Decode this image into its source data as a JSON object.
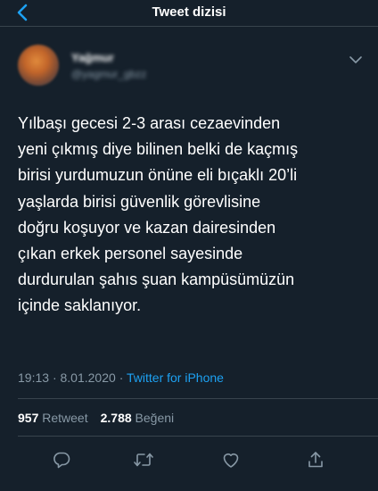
{
  "header": {
    "title": "Tweet dizisi",
    "back_icon": "chevron-left-icon"
  },
  "author": {
    "name": "Yağmur",
    "handle": "@yagmur_gbzz",
    "avatar_icon": "avatar",
    "menu_icon": "chevron-down-icon"
  },
  "tweet": {
    "lines": [
      "Yılbaşı gecesi 2-3 arası cezaevinden",
      "yeni çıkmış diye bilinen belki de kaçmış",
      "birisi yurdumuzun önüne eli bıçaklı 20’li",
      "yaşlarda birisi güvenlik görevlisine",
      "doğru koşuyor ve kazan dairesinden",
      "çıkan erkek personel sayesinde",
      "durdurulan şahıs şuan kampüsümüzün",
      "içinde saklanıyor."
    ],
    "time": "19:13",
    "date": "8.01.2020",
    "separator": "·",
    "source": "Twitter for iPhone"
  },
  "stats": {
    "retweets_count": "957",
    "retweets_label": "Retweet",
    "likes_count": "2.788",
    "likes_label": "Beğeni"
  },
  "actions": [
    {
      "name": "reply",
      "icon": "reply-icon"
    },
    {
      "name": "retweet",
      "icon": "retweet-icon"
    },
    {
      "name": "like",
      "icon": "heart-icon"
    },
    {
      "name": "share",
      "icon": "share-icon"
    }
  ],
  "colors": {
    "background": "#15202b",
    "accent": "#1da1f2",
    "muted": "#8899a6",
    "divider": "#38444d"
  }
}
